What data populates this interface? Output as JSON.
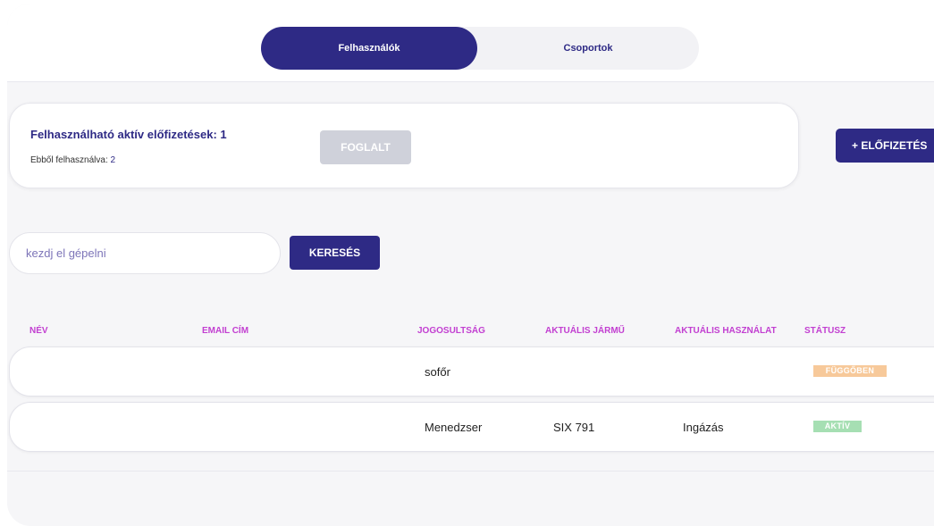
{
  "tabs": [
    {
      "label": "Felhasználók",
      "active": true
    },
    {
      "label": "Csoportok",
      "active": false
    }
  ],
  "subscription": {
    "title": "Felhasználható aktív előfizetések: 1",
    "used_label": "Ebből felhasználva:",
    "used_value": "2",
    "status_button": "FOGLALT",
    "add_button": "+ ELŐFIZETÉS"
  },
  "search": {
    "placeholder": "kezdj el gépelni",
    "button_label": "KERESÉS"
  },
  "table": {
    "headers": {
      "name": "NÉV",
      "email": "EMAIL CÍM",
      "role": "JOGOSULTSÁG",
      "vehicle": "AKTUÁLIS JÁRMŰ",
      "usage": "AKTUÁLIS HASZNÁLAT",
      "status": "STÁTUSZ"
    },
    "rows": [
      {
        "name": "",
        "email": "",
        "role": "sofőr",
        "vehicle": "",
        "usage": "",
        "status": "FÜGGŐBEN"
      },
      {
        "name": "",
        "email": "",
        "role": "Menedzser",
        "vehicle": "SIX 791",
        "usage": "Ingázás",
        "status": "AKTÍV"
      }
    ]
  },
  "colors": {
    "primary": "#2e2a85",
    "header_text": "#c23fd1",
    "status_pending": "#f7c99a",
    "status_active": "#a6dfb3",
    "disabled_button": "#cfd1da"
  }
}
